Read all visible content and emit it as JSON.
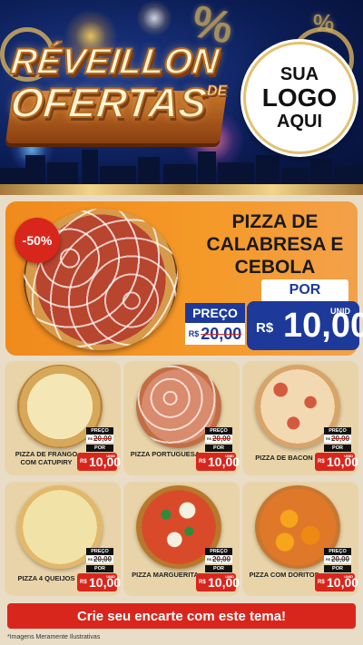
{
  "header": {
    "title_line1": "RÉVEILLON",
    "title_de": "DE",
    "title_line2": "OFERTAS",
    "logo": {
      "line1": "SUA",
      "line2": "LOGO",
      "line3": "AQUI"
    }
  },
  "feature": {
    "discount": "-50%",
    "name": "PIZZA DE CALABRESA E CEBOLA",
    "preco_label": "PREÇO",
    "old_currency": "R$",
    "old_price": "20,00",
    "por_label": "POR",
    "currency": "R$",
    "price": "10,00",
    "unit": "UNID"
  },
  "labels": {
    "preco": "PREÇO",
    "por": "POR",
    "currency": "R$",
    "unit": "UNID"
  },
  "products": [
    {
      "name": "PIZZA DE FRANGO COM CATUPIRY",
      "old_price": "20,00",
      "price": "10,00"
    },
    {
      "name": "PIZZA PORTUGUESA",
      "old_price": "20,00",
      "price": "10,00"
    },
    {
      "name": "PIZZA DE BACON",
      "old_price": "20,00",
      "price": "10,00"
    },
    {
      "name": "PIZZA 4 QUEIJOS",
      "old_price": "20,00",
      "price": "10,00"
    },
    {
      "name": "PIZZA MARGUERITA",
      "old_price": "20,00",
      "price": "10,00"
    },
    {
      "name": "PIZZA COM DORITOS",
      "old_price": "20,00",
      "price": "10,00"
    }
  ],
  "footer": {
    "cta": "Crie seu encarte com este tema!",
    "disclaimer": "*Imagens Meramente Ilustrativas"
  },
  "colors": {
    "header_bg": "#0b1d55",
    "gold": "#d9b35c",
    "feature_bg": "#f08a1c",
    "price_blue": "#1d3a9a",
    "price_red": "#d9261c",
    "card_bg": "#e9d4a9",
    "page_bg": "#e9ddc8"
  }
}
